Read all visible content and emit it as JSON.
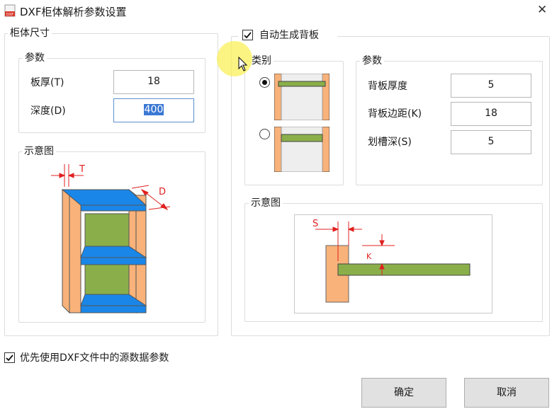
{
  "window": {
    "title": "DXF柜体解析参数设置",
    "close_glyph": "✕",
    "app_icon_letters": "DXF"
  },
  "cabinet_size": {
    "group_label": "柜体尺寸",
    "params": {
      "group_label": "参数",
      "thickness_label": "板厚(T)",
      "thickness_value": "18",
      "depth_label": "深度(D)",
      "depth_value": "400"
    },
    "diagram": {
      "group_label": "示意图",
      "t_label": "T",
      "d_label": "D"
    }
  },
  "back_panel": {
    "auto_generate_label": "自动生成背板",
    "auto_generate_checked": true,
    "category": {
      "group_label": "类别",
      "options": [
        {
          "selected": true
        },
        {
          "selected": false
        }
      ]
    },
    "params": {
      "group_label": "参数",
      "thickness_label": "背板厚度",
      "thickness_value": "5",
      "margin_label": "背板边距(K)",
      "margin_value": "18",
      "groove_label": "划槽深(S)",
      "groove_value": "5"
    },
    "diagram": {
      "group_label": "示意图",
      "s_label": "S",
      "k_label": "K"
    }
  },
  "prefer_source": {
    "label": "优先使用DXF文件中的源数据参数",
    "checked": true
  },
  "buttons": {
    "ok": "确定",
    "cancel": "取消"
  },
  "colors": {
    "panel_orange": "#f8b27a",
    "shelf_blue": "#1a86e8",
    "back_green": "#8aaf4a",
    "dim_red": "#e02020",
    "selection_blue": "#3a78d4"
  }
}
